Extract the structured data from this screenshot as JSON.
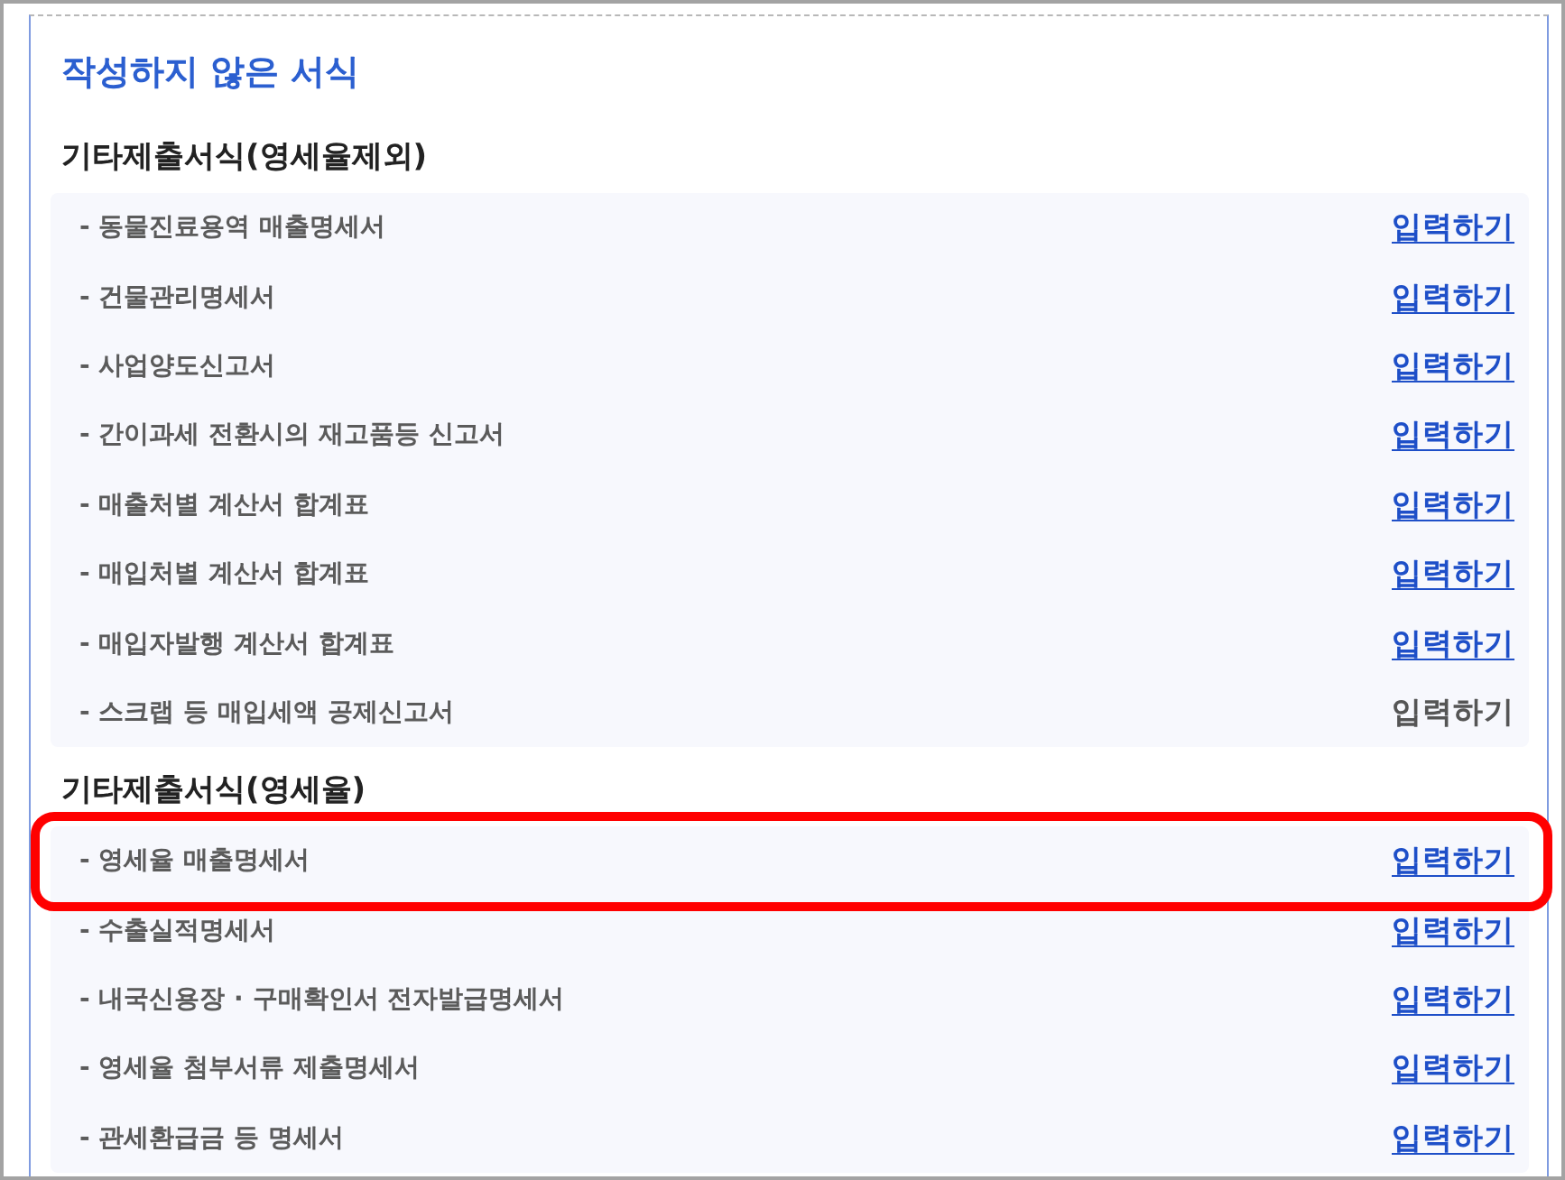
{
  "panel": {
    "title": "작성하지 않은 서식",
    "sections": [
      {
        "heading": "기타제출서식(영세율제외)",
        "items": [
          {
            "name": "- 동물진료용역 매출명세서",
            "action": "입력하기",
            "disabled": false,
            "highlighted": false
          },
          {
            "name": "- 건물관리명세서",
            "action": "입력하기",
            "disabled": false,
            "highlighted": false
          },
          {
            "name": "- 사업양도신고서",
            "action": "입력하기",
            "disabled": false,
            "highlighted": false
          },
          {
            "name": "- 간이과세 전환시의 재고품등 신고서",
            "action": "입력하기",
            "disabled": false,
            "highlighted": false
          },
          {
            "name": "- 매출처별 계산서 합계표",
            "action": "입력하기",
            "disabled": false,
            "highlighted": false
          },
          {
            "name": "- 매입처별 계산서 합계표",
            "action": "입력하기",
            "disabled": false,
            "highlighted": false
          },
          {
            "name": "- 매입자발행 계산서 합계표",
            "action": "입력하기",
            "disabled": false,
            "highlighted": false
          },
          {
            "name": "- 스크랩 등 매입세액 공제신고서",
            "action": "입력하기",
            "disabled": true,
            "highlighted": false
          }
        ]
      },
      {
        "heading": "기타제출서식(영세율)",
        "items": [
          {
            "name": "- 영세율 매출명세서",
            "action": "입력하기",
            "disabled": false,
            "highlighted": true
          },
          {
            "name": "- 수출실적명세서",
            "action": "입력하기",
            "disabled": false,
            "highlighted": false
          },
          {
            "name": "- 내국신용장 · 구매확인서 전자발급명세서",
            "action": "입력하기",
            "disabled": false,
            "highlighted": false
          },
          {
            "name": "- 영세율 첨부서류 제출명세서",
            "action": "입력하기",
            "disabled": false,
            "highlighted": false
          },
          {
            "name": "- 관세환급금 등 명세서",
            "action": "입력하기",
            "disabled": false,
            "highlighted": false
          }
        ]
      }
    ]
  }
}
